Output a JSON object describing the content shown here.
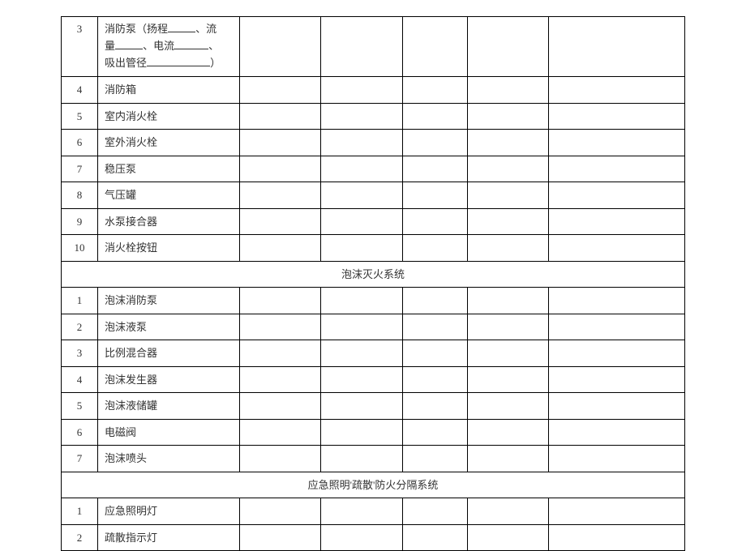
{
  "sectionA": {
    "rows": [
      {
        "num": "3",
        "name_plain": "",
        "name_has_blanks": true
      },
      {
        "num": "4",
        "name": "消防箱"
      },
      {
        "num": "5",
        "name": "室内消火栓"
      },
      {
        "num": "6",
        "name": "室外消火栓"
      },
      {
        "num": "7",
        "name": "稳压泵"
      },
      {
        "num": "8",
        "name": "气压罐"
      },
      {
        "num": "9",
        "name": "水泵接合器"
      },
      {
        "num": "10",
        "name": "消火栓按钮"
      }
    ]
  },
  "sectionB": {
    "title": "泡沫灭火系统",
    "rows": [
      {
        "num": "1",
        "name": "泡沫消防泵"
      },
      {
        "num": "2",
        "name": "泡沫液泵"
      },
      {
        "num": "3",
        "name": "比例混合器"
      },
      {
        "num": "4",
        "name": "泡沫发生器"
      },
      {
        "num": "5",
        "name": "泡沫液储罐"
      },
      {
        "num": "6",
        "name": "电磁阀"
      },
      {
        "num": "7",
        "name": "泡沫喷头"
      }
    ]
  },
  "sectionC": {
    "title": "应急照明'疏散'防火分隔系统",
    "rows": [
      {
        "num": "1",
        "name": "应急照明灯"
      },
      {
        "num": "2",
        "name": "疏散指示灯"
      }
    ]
  },
  "pump_label": {
    "p1": "消防泵（扬程",
    "p2": "、流",
    "p3": "量",
    "p4": "、电流",
    "p5": "、",
    "p6": "吸出管径",
    "p7": "）"
  }
}
